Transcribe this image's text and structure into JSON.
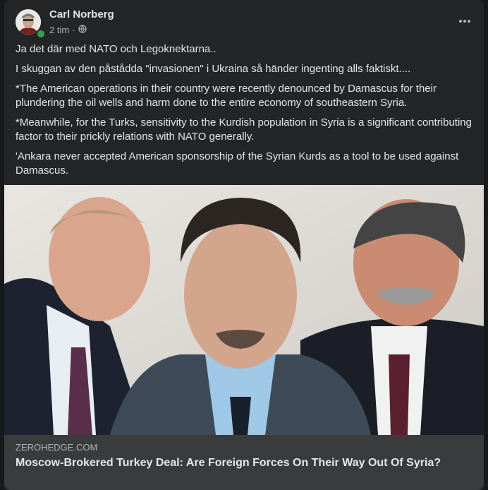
{
  "post": {
    "author": "Carl Norberg",
    "time": "2 tim",
    "separator": "·",
    "icons": {
      "privacy": "globe-icon",
      "menu": "more-options-icon",
      "status": "online-indicator"
    },
    "paragraphs": [
      "Ja det där med NATO och Legoknektarna..",
      "I skuggan av den påstådda \"invasionen\" i Ukraina så händer ingenting alls faktiskt....",
      "*The American operations in their country were recently denounced by Damascus for their plundering the oil wells and harm done to the entire economy of southeastern Syria.",
      "*Meanwhile, for the Turks, sensitivity to the Kurdish population in Syria is a significant contributing factor to their prickly relations with NATO generally.",
      "'Ankara never accepted American sponsorship of the Syrian Kurds as a tool to be used against Damascus."
    ]
  },
  "link": {
    "domain": "ZEROHEDGE.COM",
    "title": "Moscow-Brokered Turkey Deal: Are Foreign Forces On Their Way Out Of Syria?"
  },
  "colors": {
    "background": "#18191a",
    "card": "#242526",
    "text_primary": "#e4e6eb",
    "text_secondary": "#b0b3b8",
    "link_box": "#3a3b3c",
    "online": "#31a24c"
  }
}
